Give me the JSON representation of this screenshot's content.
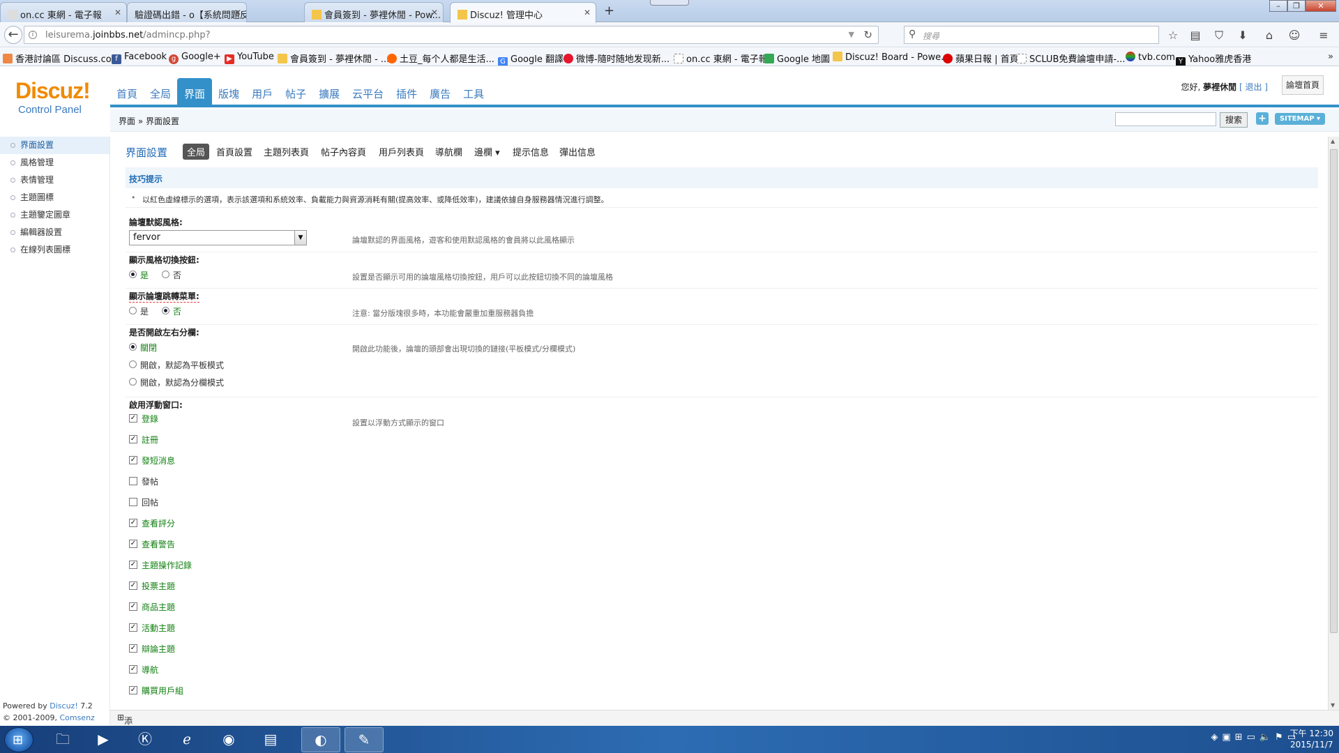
{
  "browser": {
    "tabs": [
      {
        "label": "on.cc 東網 - 電子報",
        "active": false
      },
      {
        "label": "驗證碼出錯 - o【系統問題反應...",
        "active": false
      },
      {
        "label": "會員簽到 - 夢裡休閒 - Pow...",
        "active": false
      },
      {
        "label": "Discuz! 管理中心",
        "active": true
      }
    ],
    "url_prefix": "leisurema.",
    "url_host": "joinbbs.net",
    "url_path": "/admincp.php?",
    "search_placeholder": "搜尋",
    "bookmarks": [
      "香港討論區 Discuss.co...",
      "Facebook",
      "Google+",
      "YouTube",
      "會員簽到 - 夢裡休閒 - ...",
      "土豆_每个人都是生活...",
      "Google 翻譯",
      "微博-隨时随地发现新...",
      "on.cc 東網 - 電子報",
      "Google 地圖",
      "Discuz! Board - Powe...",
      "蘋果日報 | 首頁",
      "SCLUB免費論壇申請-...",
      "tvb.com",
      "Yahoo雅虎香港"
    ]
  },
  "header": {
    "logo_main": "Discuz!",
    "logo_sub": "Control Panel",
    "nav": [
      "首頁",
      "全局",
      "界面",
      "版塊",
      "用戶",
      "帖子",
      "擴展",
      "云平台",
      "插件",
      "廣告",
      "工具"
    ],
    "nav_active_index": 2,
    "greeting_prefix": "您好, ",
    "username": "夢裡休閒",
    "logout": "[ 退出 ]",
    "home_button": "論壇首頁"
  },
  "sidebar": {
    "items": [
      "界面設置",
      "風格管理",
      "表情管理",
      "主題圖標",
      "主題鑒定圖章",
      "編輯器設置",
      "在線列表圖標"
    ],
    "active_index": 0,
    "powered_prefix": "Powered by ",
    "powered_brand": "Discuz!",
    "powered_version": " 7.2",
    "copyright_prefix": "© 2001-2009, ",
    "copyright_company": "Comsenz Inc."
  },
  "breadcrumb": {
    "text": "界面 » 界面設置",
    "search_button": "搜索",
    "plus": "+",
    "sitemap": "SITEMAP ▾"
  },
  "subnav": {
    "title": "界面設置",
    "tabs": [
      "全局",
      "首頁設置",
      "主題列表頁",
      "帖子內容頁",
      "用戶列表頁",
      "導航欄",
      "邊欄 ▾",
      "提示信息",
      "彈出信息"
    ],
    "active_index": 0
  },
  "tips": {
    "heading": "技巧提示",
    "text": "以紅色虛線標示的選項，表示該選項和系統效率、負載能力與資源消耗有關(提高效率、或降低效率)，建議依據自身服務器情況進行調整。"
  },
  "settings": {
    "default_style": {
      "label": "論壇默認風格:",
      "value": "fervor",
      "desc": "論壇默認的界面風格，遊客和使用默認風格的會員將以此風格顯示"
    },
    "style_switch": {
      "label": "顯示風格切換按鈕:",
      "yes": "是",
      "no": "否",
      "selected": "yes",
      "desc": "設置是否顯示可用的論壇風格切換按鈕，用戶可以此按鈕切換不同的論壇風格"
    },
    "jump_menu": {
      "label": "顯示論壇跳轉菜單:",
      "yes": "是",
      "no": "否",
      "selected": "no",
      "desc": "注意: 當分版塊很多時，本功能會嚴重加重服務器負擔"
    },
    "columns": {
      "label": "是否開啟左右分欄:",
      "options": [
        "關閉",
        "開啟，默認為平板模式",
        "開啟，默認為分欄模式"
      ],
      "selected": 0,
      "desc": "開啟此功能後，論壇的頭部會出現切換的鏈接(平板模式/分欄模式)"
    },
    "float_windows": {
      "label": "啟用浮動窗口:",
      "desc": "設置以浮動方式顯示的窗口",
      "items": [
        {
          "label": "登錄",
          "checked": true
        },
        {
          "label": "註冊",
          "checked": true
        },
        {
          "label": "發短消息",
          "checked": true
        },
        {
          "label": "發帖",
          "checked": false
        },
        {
          "label": "回帖",
          "checked": false
        },
        {
          "label": "查看評分",
          "checked": true
        },
        {
          "label": "查看警告",
          "checked": true
        },
        {
          "label": "主題操作記錄",
          "checked": true
        },
        {
          "label": "投票主題",
          "checked": true
        },
        {
          "label": "商品主題",
          "checked": true
        },
        {
          "label": "活動主題",
          "checked": true
        },
        {
          "label": "辯論主題",
          "checked": true
        },
        {
          "label": "導航",
          "checked": true
        },
        {
          "label": "購買用戶組",
          "checked": true
        }
      ]
    }
  },
  "footer": {
    "add_task": "添加到任務欄"
  },
  "taskbar": {
    "time": "下午 12:30",
    "date": "2015/11/7"
  },
  "colors": {
    "accent": "#3390c9",
    "logo_orange": "#f08a00",
    "link_blue": "#3a7abf",
    "option_green": "#108010"
  }
}
